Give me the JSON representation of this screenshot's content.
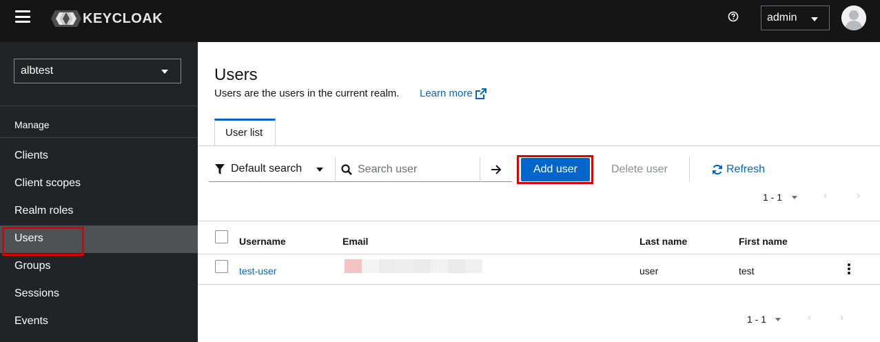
{
  "topbar": {
    "brand": "KEYCLOAK",
    "user_select": "admin",
    "icons": {
      "menu": "hamburger-icon",
      "help": "question-circle-icon",
      "avatar": "user-avatar-icon"
    }
  },
  "sidebar": {
    "realm": "albtest",
    "section": "Manage",
    "items": [
      {
        "label": "Clients"
      },
      {
        "label": "Client scopes"
      },
      {
        "label": "Realm roles"
      },
      {
        "label": "Users",
        "active": true
      },
      {
        "label": "Groups"
      },
      {
        "label": "Sessions"
      },
      {
        "label": "Events"
      }
    ]
  },
  "main": {
    "title": "Users",
    "description": "Users are the users in the current realm.",
    "learn_more": "Learn more",
    "tabs": [
      {
        "label": "User list",
        "active": true
      }
    ],
    "toolbar": {
      "filter": "Default search",
      "search_placeholder": "Search user",
      "add_user": "Add user",
      "delete_user": "Delete user",
      "refresh": "Refresh"
    },
    "pagination": {
      "range": "1 - 1"
    },
    "table": {
      "columns": [
        "Username",
        "Email",
        "Last name",
        "First name"
      ],
      "rows": [
        {
          "username": "test-user",
          "email": "",
          "last_name": "user",
          "first_name": "test"
        }
      ]
    }
  },
  "colors": {
    "accent": "#0066cc",
    "topbar": "#151515",
    "sidebar": "#212427",
    "highlight": "#e00000"
  }
}
